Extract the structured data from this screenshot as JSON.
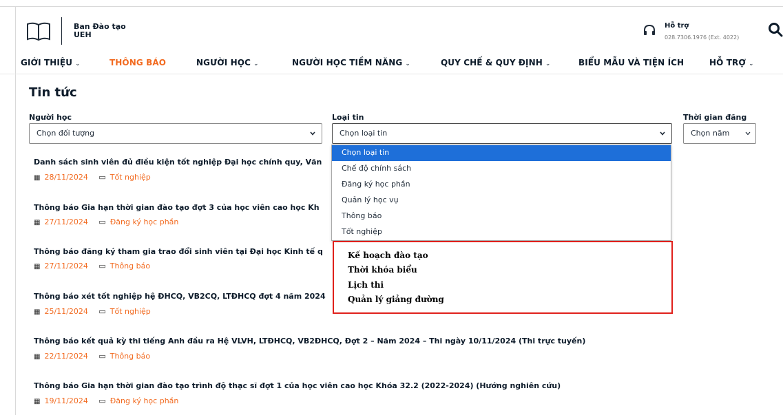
{
  "header": {
    "org_line1": "Ban Đào tạo",
    "org_line2": "UEH",
    "support_title": "Hỗ trợ",
    "support_phone": "028.7306.1976 (Ext. 4022)"
  },
  "nav": {
    "items": [
      {
        "label": "GIỚI THIỆU",
        "chevron": "⌄"
      },
      {
        "label": "THÔNG BÁO",
        "chevron": ""
      },
      {
        "label": "NGƯỜI HỌC",
        "chevron": "⌄"
      },
      {
        "label": "NGƯỜI HỌC TIỀM NĂNG",
        "chevron": "⌄"
      },
      {
        "label": "QUY CHẾ & QUY ĐỊNH",
        "chevron": "⌄"
      },
      {
        "label": "BIỂU MẪU VÀ TIỆN ÍCH",
        "chevron": ""
      },
      {
        "label": "HỖ TRỢ",
        "chevron": "⌄"
      }
    ],
    "active_color": "#f26b21"
  },
  "page": {
    "title": "Tin tức"
  },
  "filters": {
    "learner_label": "Người học",
    "learner_value": "Chọn đối tượng",
    "type_label": "Loại tin",
    "type_value": "Chọn loại tin",
    "time_label": "Thời gian đăng",
    "time_value": "Chọn năm"
  },
  "dropdown": {
    "options": [
      "Chọn loại tin",
      "Chế độ chính sách",
      "Đăng ký học phần",
      "Quản lý học vụ",
      "Thông báo",
      "Tốt nghiệp"
    ],
    "selected_index": 0,
    "highlight_color": "#1e6fd9"
  },
  "annotation": {
    "items": [
      "Kế hoạch đào tạo",
      "Thời khóa biểu",
      "Lịch thi",
      "Quản lý giảng đường"
    ],
    "border_color": "#e0201b"
  },
  "news": [
    {
      "title": "Danh sách sinh viên đủ điều kiện tốt nghiệp Đại học chính quy, Văn",
      "date": "28/11/2024",
      "category": "Tốt nghiệp"
    },
    {
      "title": "Thông báo Gia hạn thời gian đào tạo đợt 3 của học viên cao học Kh",
      "date": "27/11/2024",
      "category": "Đăng ký học phần"
    },
    {
      "title": "Thông báo đăng ký tham gia trao đổi sinh viên tại Đại học Kinh tế q",
      "date": "27/11/2024",
      "category": "Thông báo"
    },
    {
      "title": "Thông báo xét tốt nghiệp hệ ĐHCQ, VB2CQ, LTĐHCQ đợt 4 năm 2024",
      "date": "25/11/2024",
      "category": "Tốt nghiệp"
    },
    {
      "title": "Thông báo kết quả kỳ thi tiếng Anh đầu ra Hệ VLVH, LTĐHCQ, VB2ĐHCQ, Đợt 2 – Năm 2024 – Thi ngày 10/11/2024 (Thi trực tuyến)",
      "date": "22/11/2024",
      "category": "Thông báo"
    },
    {
      "title": "Thông báo Gia hạn thời gian đào tạo trình độ thạc sĩ đợt 1 của học viên cao học Khóa 32.2 (2022-2024) (Hướng nghiên cứu)",
      "date": "19/11/2024",
      "category": "Đăng ký học phần"
    }
  ]
}
